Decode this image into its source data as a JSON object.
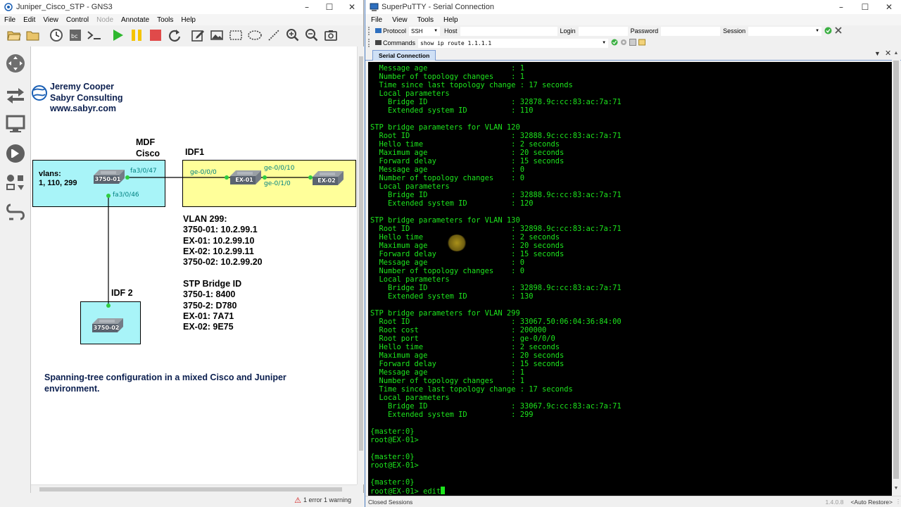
{
  "gns3": {
    "title": "Juniper_Cisco_STP - GNS3",
    "menu": [
      "File",
      "Edit",
      "View",
      "Control",
      "Node",
      "Annotate",
      "Tools",
      "Help"
    ],
    "menu_disabled": [
      "Node"
    ],
    "toolbar_icons": [
      "open-folder-icon",
      "folder-icon",
      "clock-icon",
      "snapshot-icon",
      "console-icon",
      "start-icon",
      "pause-icon",
      "stop-icon",
      "reload-icon",
      "note-icon",
      "image-icon",
      "rectangle-icon",
      "ellipse-icon",
      "line-icon",
      "zoom-in-icon",
      "zoom-out-icon",
      "screenshot-icon"
    ],
    "left_tools": [
      "routers-icon",
      "switches-icon",
      "end-devices-icon",
      "security-icon",
      "all-devices-icon",
      "add-link-icon"
    ],
    "status": {
      "text": "1 error 1 warning",
      "accent": "#d01818"
    },
    "canvas": {
      "author": [
        "Jeremy Cooper",
        "Sabyr Consulting",
        "www.sabyr.com"
      ],
      "mdf_label": [
        "MDF",
        "Cisco"
      ],
      "idf1_label": "IDF1",
      "idf2_label": "IDF 2",
      "vlans_note": [
        "vlans:",
        "1, 110, 299"
      ],
      "devices": {
        "sw1": "3750-01",
        "ex1": "EX-01",
        "ex2": "EX-02",
        "sw2": "3750-02"
      },
      "ports": {
        "fa3_0_47": "fa3/0/47",
        "fa3_0_46": "fa3/0/46",
        "ge_0_0_0": "ge-0/0/0",
        "ge_0_0_10": "ge-0/0/10",
        "ge_0_1_0": "ge-0/1/0"
      },
      "vlan_info": [
        "VLAN 299:",
        "3750-01: 10.2.99.1",
        "EX-01: 10.2.99.10",
        "EX-02: 10.2.99.11",
        "3750-02: 10.2.99.20"
      ],
      "bridge_info": [
        "STP Bridge ID",
        "3750-1: 8400",
        "3750-2: D780",
        "EX-01: 7A71",
        "EX-02: 9E75"
      ],
      "description": [
        "Spanning-tree configuration in a mixed Cisco and Juniper",
        "environment."
      ],
      "colors": {
        "mdf_zone": "#a8f4f8",
        "idf1_zone": "#ffff9a",
        "idf2_zone": "#a8f4f8",
        "port_label": "#008080",
        "link_dot": "#2ecc40"
      }
    }
  },
  "putty": {
    "title": "SuperPuTTY - Serial Connection",
    "menu": [
      "File",
      "View",
      "Tools",
      "Help"
    ],
    "protocol_label": "Protocol",
    "protocol_value": "SSH",
    "host_label": "Host",
    "login_label": "Login",
    "password_label": "Password",
    "session_label": "Session",
    "commands_label": "Commands",
    "commands_value": "show ip route 1.1.1.1",
    "tab_label": "Serial Connection",
    "terminal": [
      "  Message age                   : 1",
      "  Number of topology changes    : 1",
      "  Time since last topology change : 17 seconds",
      "  Local parameters",
      "    Bridge ID                   : 32878.9c:cc:83:ac:7a:71",
      "    Extended system ID          : 110",
      "",
      "STP bridge parameters for VLAN 120",
      "  Root ID                       : 32888.9c:cc:83:ac:7a:71",
      "  Hello time                    : 2 seconds",
      "  Maximum age                   : 20 seconds",
      "  Forward delay                 : 15 seconds",
      "  Message age                   : 0",
      "  Number of topology changes    : 0",
      "  Local parameters",
      "    Bridge ID                   : 32888.9c:cc:83:ac:7a:71",
      "    Extended system ID          : 120",
      "",
      "STP bridge parameters for VLAN 130",
      "  Root ID                       : 32898.9c:cc:83:ac:7a:71",
      "  Hello time                    : 2 seconds",
      "  Maximum age                   : 20 seconds",
      "  Forward delay                 : 15 seconds",
      "  Message age                   : 0",
      "  Number of topology changes    : 0",
      "  Local parameters",
      "    Bridge ID                   : 32898.9c:cc:83:ac:7a:71",
      "    Extended system ID          : 130",
      "",
      "STP bridge parameters for VLAN 299",
      "  Root ID                       : 33067.50:06:04:36:84:00",
      "  Root cost                     : 200000",
      "  Root port                     : ge-0/0/0",
      "  Hello time                    : 2 seconds",
      "  Maximum age                   : 20 seconds",
      "  Forward delay                 : 15 seconds",
      "  Message age                   : 1",
      "  Number of topology changes    : 1",
      "  Time since last topology change : 17 seconds",
      "  Local parameters",
      "    Bridge ID                   : 33067.9c:cc:83:ac:7a:71",
      "    Extended system ID          : 299",
      "",
      "{master:0}",
      "root@EX-01>",
      "",
      "{master:0}",
      "root@EX-01>",
      "",
      "{master:0}",
      "root@EX-01> edit"
    ],
    "status_left": "Closed Sessions",
    "version": "1.4.0.8",
    "auto_restore": "<Auto Restore>",
    "terminal_color": "#1de51d"
  }
}
